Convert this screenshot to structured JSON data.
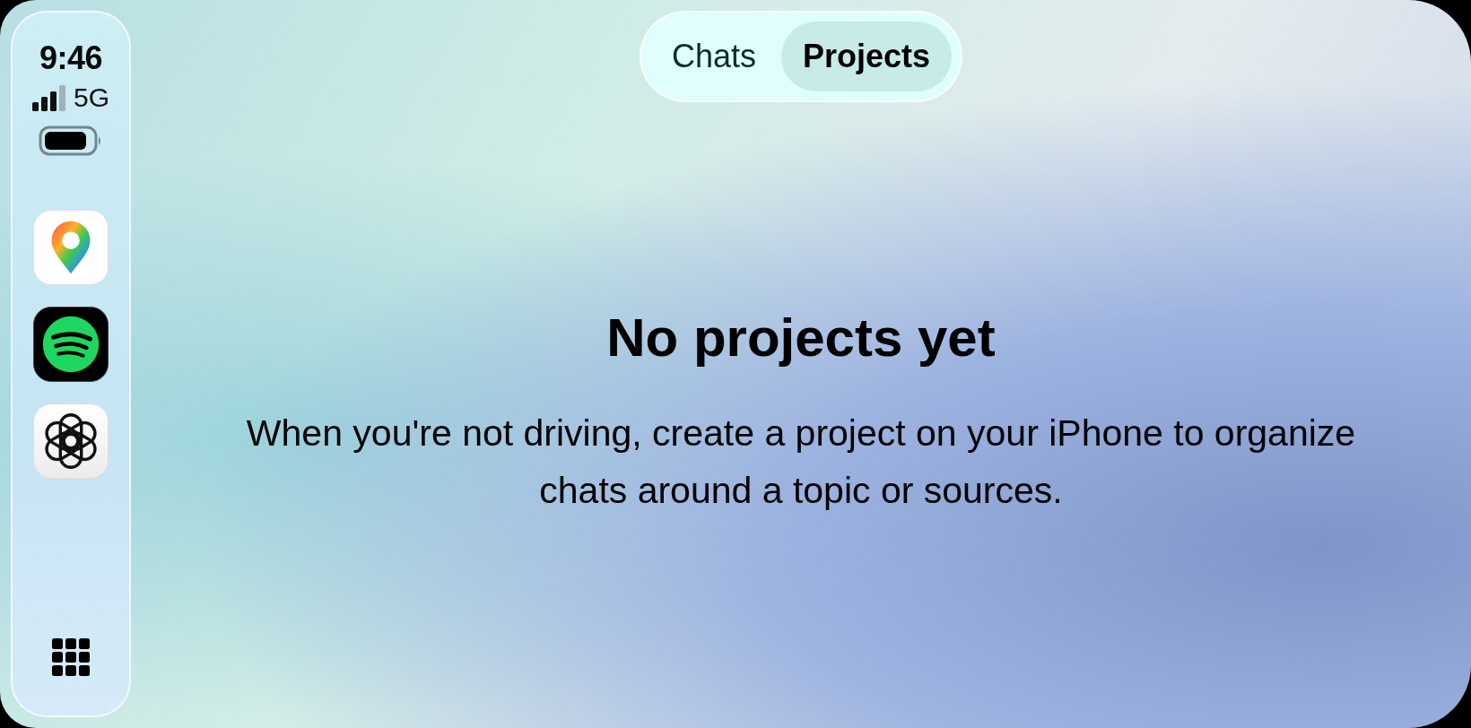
{
  "status_bar": {
    "time": "9:46",
    "network": "5G"
  },
  "dock": {
    "apps": [
      {
        "kind": "maps"
      },
      {
        "kind": "music"
      },
      {
        "kind": "assistant"
      }
    ]
  },
  "tabs": [
    {
      "label": "Chats",
      "selected": false
    },
    {
      "label": "Projects",
      "selected": true
    }
  ],
  "empty_state": {
    "title": "No projects yet",
    "message": "When you're not driving, create a project on your iPhone to organize chats around a topic or sources."
  }
}
